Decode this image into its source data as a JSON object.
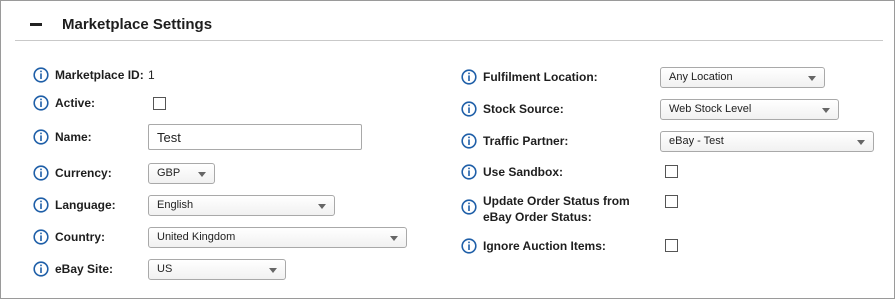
{
  "section": {
    "title": "Marketplace Settings"
  },
  "left": {
    "marketplace_id": {
      "label": "Marketplace ID:",
      "value": "1"
    },
    "active": {
      "label": "Active:",
      "checked": false
    },
    "name": {
      "label": "Name:",
      "value": "Test"
    },
    "currency": {
      "label": "Currency:",
      "value": "GBP"
    },
    "language": {
      "label": "Language:",
      "value": "English"
    },
    "country": {
      "label": "Country:",
      "value": "United Kingdom"
    },
    "ebay_site": {
      "label": "eBay Site:",
      "value": "US"
    }
  },
  "right": {
    "fulfilment_location": {
      "label": "Fulfilment Location:",
      "value": "Any Location"
    },
    "stock_source": {
      "label": "Stock Source:",
      "value": "Web Stock Level"
    },
    "traffic_partner": {
      "label": "Traffic Partner:",
      "value": "eBay - Test"
    },
    "use_sandbox": {
      "label": "Use Sandbox:",
      "checked": false
    },
    "update_order_status": {
      "label": "Update Order Status from eBay Order Status:",
      "checked": false
    },
    "ignore_auction_items": {
      "label": "Ignore Auction Items:",
      "checked": false
    }
  },
  "colors": {
    "info_icon": "#1f5fa8",
    "border": "#a9a9a9",
    "text": "#1e1e1e"
  },
  "icons": {
    "info": "info-circle-icon",
    "collapse": "minus-icon",
    "dropdown": "chevron-down-icon"
  }
}
